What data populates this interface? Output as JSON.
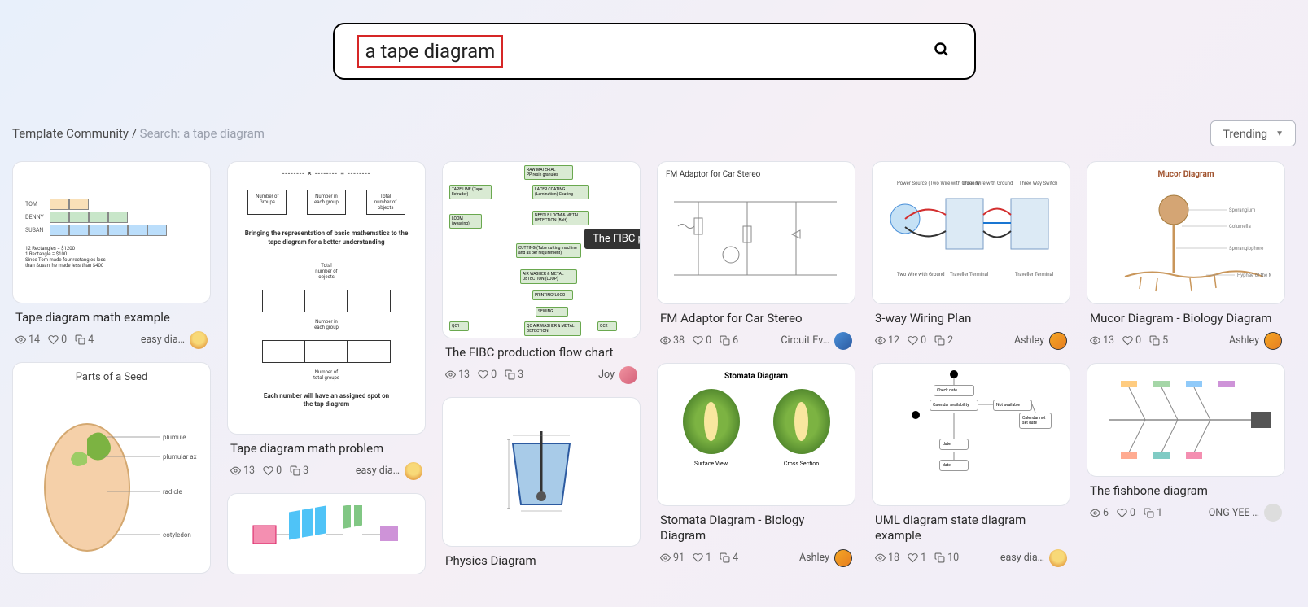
{
  "search": {
    "value": "a tape diagram"
  },
  "breadcrumb": {
    "root": "Template Community",
    "sep": "/",
    "search_label": "Search: a tape diagram"
  },
  "sort": {
    "label": "Trending"
  },
  "tooltip": "The FIBC production flow chart",
  "cards": {
    "tape_example": {
      "title": "Tape diagram math example",
      "views": "14",
      "likes": "0",
      "copies": "4",
      "author": "easy dia…"
    },
    "tape_problem": {
      "title": "Tape diagram math problem",
      "views": "13",
      "likes": "0",
      "copies": "3",
      "author": "easy dia…"
    },
    "fibc": {
      "title": "The FIBC production flow chart",
      "views": "13",
      "likes": "0",
      "copies": "3",
      "author": "Joy"
    },
    "physics": {
      "title": "Physics Diagram"
    },
    "fm": {
      "title": "FM Adaptor for Car Stereo",
      "thumb_title": "FM Adaptor for Car Stereo",
      "views": "38",
      "likes": "0",
      "copies": "6",
      "author": "Circuit Ev…"
    },
    "stomata": {
      "title": "Stomata Diagram - Biology Diagram",
      "thumb_title": "Stomata Diagram",
      "surface_label": "Surface View",
      "cross_label": "Cross Section",
      "views": "91",
      "likes": "1",
      "copies": "4",
      "author": "Ashley"
    },
    "wiring": {
      "title": "3-way Wiring Plan",
      "views": "12",
      "likes": "0",
      "copies": "2",
      "author": "Ashley"
    },
    "uml": {
      "title": "UML diagram state diagram example",
      "views": "18",
      "likes": "1",
      "copies": "10",
      "author": "easy dia…"
    },
    "mucor": {
      "title": "Mucor Diagram - Biology Diagram",
      "thumb_title": "Mucor Diagram",
      "views": "13",
      "likes": "0",
      "copies": "5",
      "author": "Ashley"
    },
    "fishbone": {
      "title": "The fishbone diagram",
      "views": "6",
      "likes": "0",
      "copies": "1",
      "author": "ONG YEE …"
    },
    "seed": {
      "thumb_title": "Parts of a Seed"
    }
  }
}
